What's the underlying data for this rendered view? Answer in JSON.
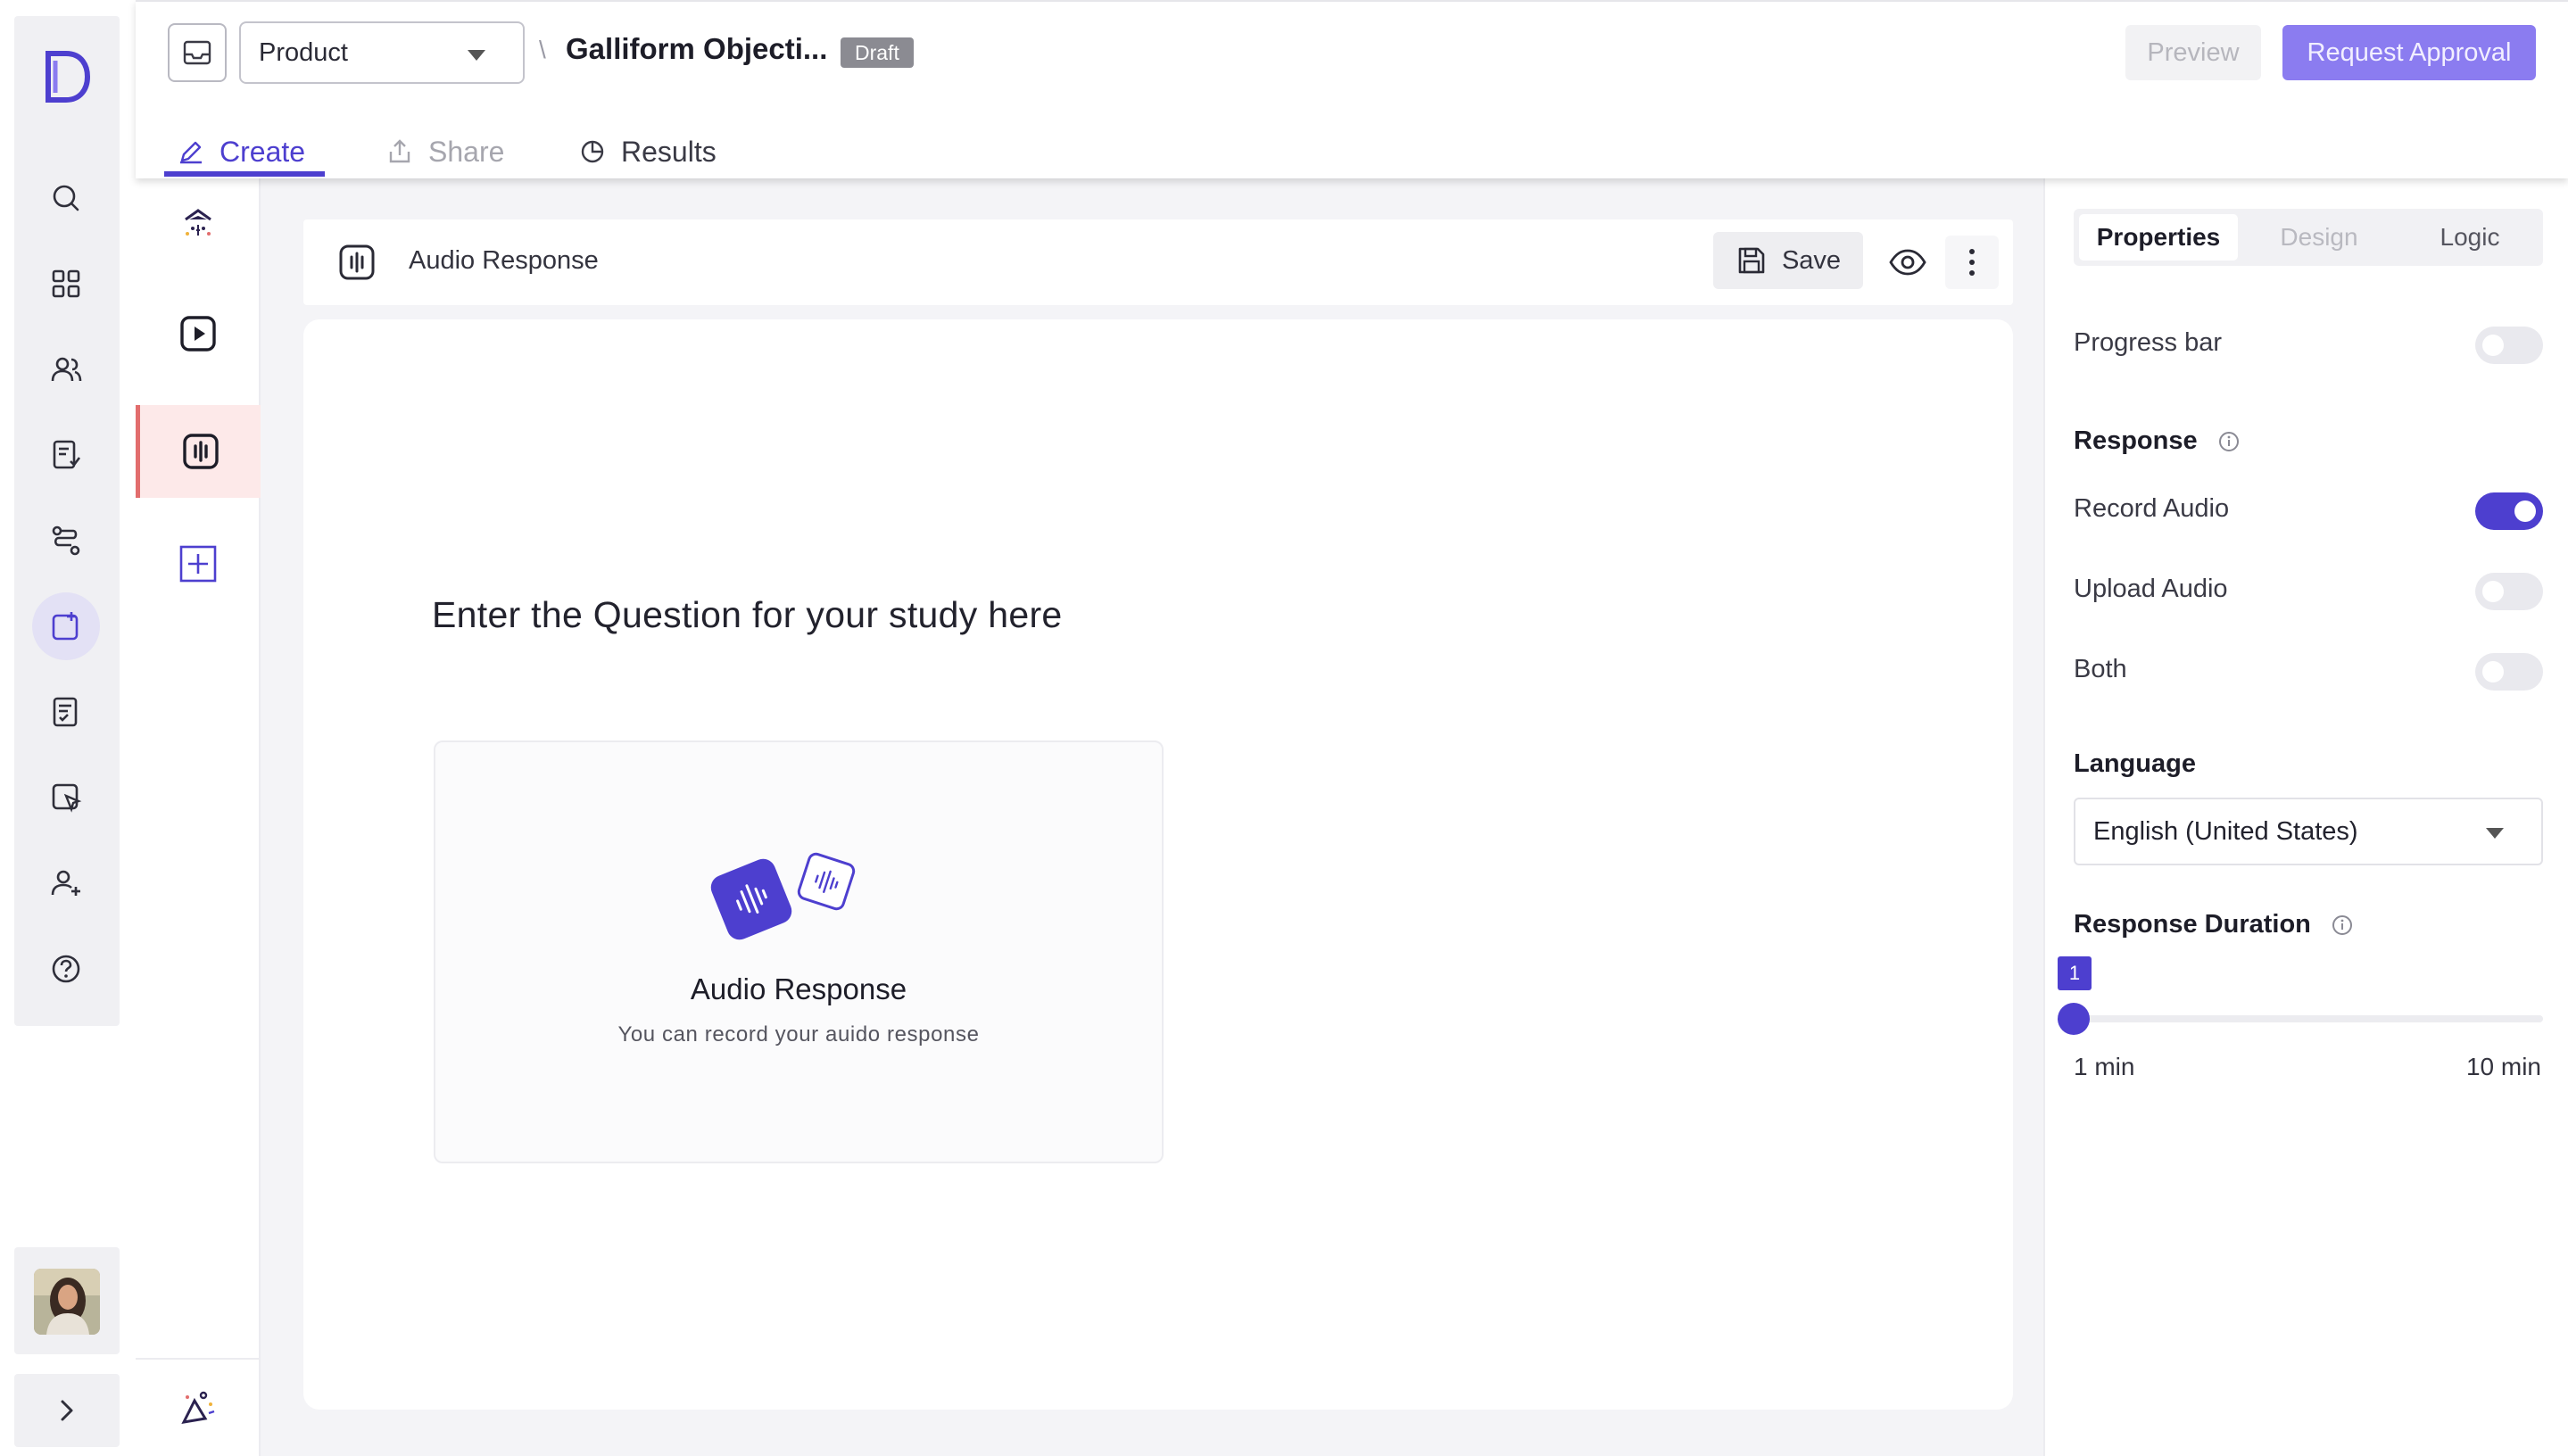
{
  "header": {
    "product_select": "Product",
    "crumb_separator": "\\",
    "study_title": "Galliform Objecti...",
    "status_badge": "Draft",
    "preview_label": "Preview",
    "request_approval_label": "Request Approval",
    "tabs": [
      {
        "label": "Create"
      },
      {
        "label": "Share"
      },
      {
        "label": "Results"
      }
    ]
  },
  "nav_rail": {
    "items": [
      "search-icon",
      "dashboard-grid-icon",
      "users-icon",
      "survey-icon",
      "journey-icon",
      "create-study-icon",
      "tasks-icon",
      "usability-test-icon",
      "add-participant-icon",
      "help-icon"
    ],
    "active_item": "create-study-icon"
  },
  "question_list": {
    "items": [
      "welcome-screen-icon",
      "video-question-icon",
      "audio-question-icon",
      "add-question-icon"
    ],
    "active_item": "audio-question-icon"
  },
  "editor": {
    "question_type_label": "Audio Response",
    "save_label": "Save",
    "question_text": "Enter the Question for your study here",
    "audio_card": {
      "title": "Audio Response",
      "subtitle": "You can record your auido response"
    }
  },
  "properties": {
    "tabs": [
      {
        "label": "Properties"
      },
      {
        "label": "Design"
      },
      {
        "label": "Logic"
      }
    ],
    "progress_bar_label": "Progress bar",
    "progress_bar_on": false,
    "response_title": "Response",
    "record_audio_label": "Record Audio",
    "record_audio_on": true,
    "upload_audio_label": "Upload Audio",
    "upload_audio_on": false,
    "both_label": "Both",
    "both_on": false,
    "language_title": "Language",
    "language_value": "English (United States)",
    "duration_title": "Response Duration",
    "duration_value": "1",
    "duration_min_label": "1 min",
    "duration_max_label": "10 min"
  },
  "colors": {
    "accent": "#4d3fcf",
    "accent_light": "#8b7cf0",
    "active_row": "#fde9e9",
    "active_border": "#e26d6d"
  }
}
